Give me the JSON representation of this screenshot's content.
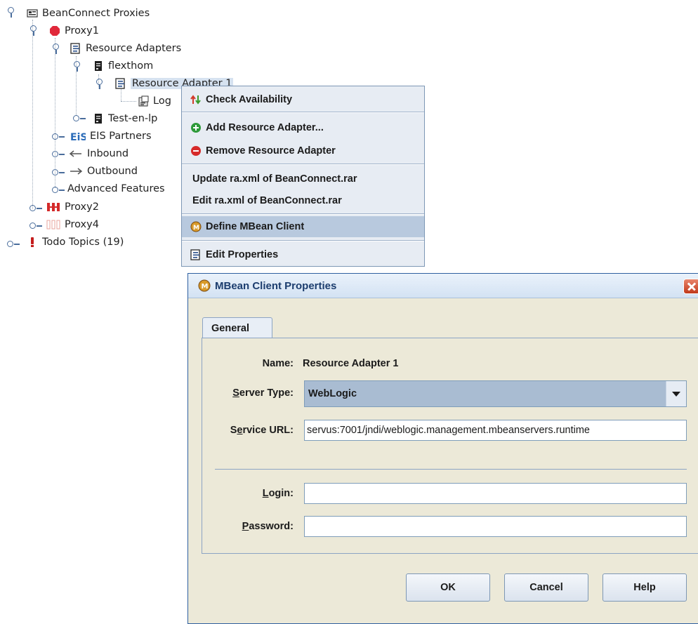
{
  "tree": {
    "root": "BeanConnect Proxies",
    "proxy1": "Proxy1",
    "resource_adapters": "Resource Adapters",
    "flexthom": "flexthom",
    "resource_adapter_1": "Resource Adapter 1",
    "log": "Log",
    "test_en_lp": "Test-en-lp",
    "eis_partners": "EIS Partners",
    "inbound": "Inbound",
    "outbound": "Outbound",
    "advanced_features": "Advanced Features",
    "proxy2": "Proxy2",
    "proxy4": "Proxy4",
    "todo_topics": "Todo Topics (19)"
  },
  "menu": {
    "check_availability": "Check Availability",
    "add_resource_adapter": "Add Resource Adapter...",
    "remove_resource_adapter": "Remove Resource Adapter",
    "update_ra_xml": "Update ra.xml of BeanConnect.rar",
    "edit_ra_xml": "Edit ra.xml of BeanConnect.rar",
    "define_mbean_client": "Define MBean Client",
    "edit_properties": "Edit Properties"
  },
  "dialog": {
    "title": "MBean Client Properties",
    "tab_general": "General",
    "name_label": "Name:",
    "name_value": "Resource Adapter 1",
    "server_type_label_pre": "",
    "server_type_label_mn": "S",
    "server_type_label_post": "erver Type:",
    "server_type_value": "WebLogic",
    "service_url_label_pre": "S",
    "service_url_label_mn": "e",
    "service_url_label_post": "rvice URL:",
    "service_url_value": "servus:7001/jndi/weblogic.management.mbeanservers.runtime",
    "login_label_pre": "",
    "login_label_mn": "L",
    "login_label_post": "ogin:",
    "login_value": "",
    "password_label_pre": "",
    "password_label_mn": "P",
    "password_label_post": "assword:",
    "password_value": "",
    "ok": "OK",
    "cancel": "Cancel",
    "help": "Help"
  },
  "colors": {
    "menu_bg": "#e7ecf3",
    "menu_selected": "#b8c9de",
    "dialog_bg": "#ece9d8",
    "combo_bg": "#a9bcd2"
  }
}
